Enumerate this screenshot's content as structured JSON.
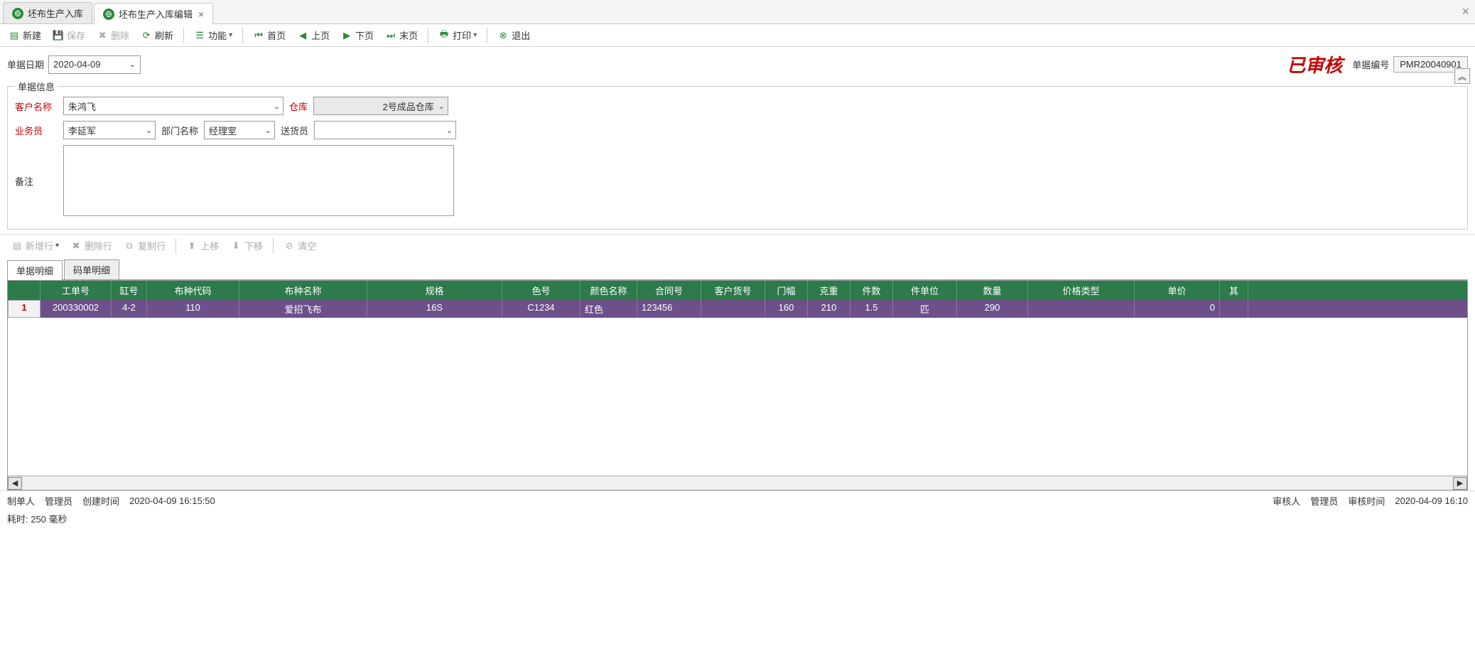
{
  "tabs": {
    "items": [
      {
        "label": "坯布生产入库"
      },
      {
        "label": "坯布生产入库编辑"
      }
    ]
  },
  "toolbar": {
    "new": "新建",
    "save": "保存",
    "delete": "删除",
    "refresh": "刷新",
    "functions": "功能",
    "first": "首页",
    "prev": "上页",
    "next": "下页",
    "last": "末页",
    "print": "打印",
    "exit": "退出"
  },
  "header": {
    "date_label": "单据日期",
    "date_value": "2020-04-09",
    "status_stamp": "已审核",
    "doc_no_label": "单据编号",
    "doc_no_value": "PMR20040901"
  },
  "form": {
    "legend": "单据信息",
    "customer_label": "客户名称",
    "customer_value": "朱鸿飞",
    "warehouse_label": "仓库",
    "warehouse_value": "2号成品仓库",
    "salesman_label": "业务员",
    "salesman_value": "李延军",
    "dept_label": "部门名称",
    "dept_value": "经理室",
    "deliverer_label": "送货员",
    "deliverer_value": "",
    "remark_label": "备注",
    "remark_value": ""
  },
  "sub_toolbar": {
    "add_row": "新增行",
    "del_row": "删除行",
    "copy_row": "复制行",
    "move_up": "上移",
    "move_down": "下移",
    "clear": "清空"
  },
  "detail_tabs": {
    "items": [
      {
        "label": "单据明细"
      },
      {
        "label": "码单明细"
      }
    ]
  },
  "grid": {
    "columns": [
      "工单号",
      "缸号",
      "布种代码",
      "布种名称",
      "规格",
      "色号",
      "颜色名称",
      "合同号",
      "客户货号",
      "门幅",
      "克重",
      "件数",
      "件单位",
      "数量",
      "价格类型",
      "单价",
      "其"
    ],
    "rows": [
      {
        "idx": "1",
        "work_order": "200330002",
        "vat_no": "4-2",
        "cloth_code": "110",
        "cloth_name": "爱招飞布",
        "spec": "16S",
        "color_no": "C1234",
        "color_name": "红色",
        "contract_no": "123456",
        "customer_item": "",
        "width": "160",
        "weight": "210",
        "pieces": "1.5",
        "piece_unit": "匹",
        "qty": "290",
        "price_type": "",
        "unit_price": "0"
      }
    ]
  },
  "footer": {
    "creator_label": "制单人",
    "creator_value": "管理员",
    "created_label": "创建时间",
    "created_value": "2020-04-09 16:15:50",
    "auditor_label": "审核人",
    "auditor_value": "管理员",
    "audited_label": "审核时间",
    "audited_value": "2020-04-09 16:10",
    "timing": "耗时: 250 毫秒"
  }
}
